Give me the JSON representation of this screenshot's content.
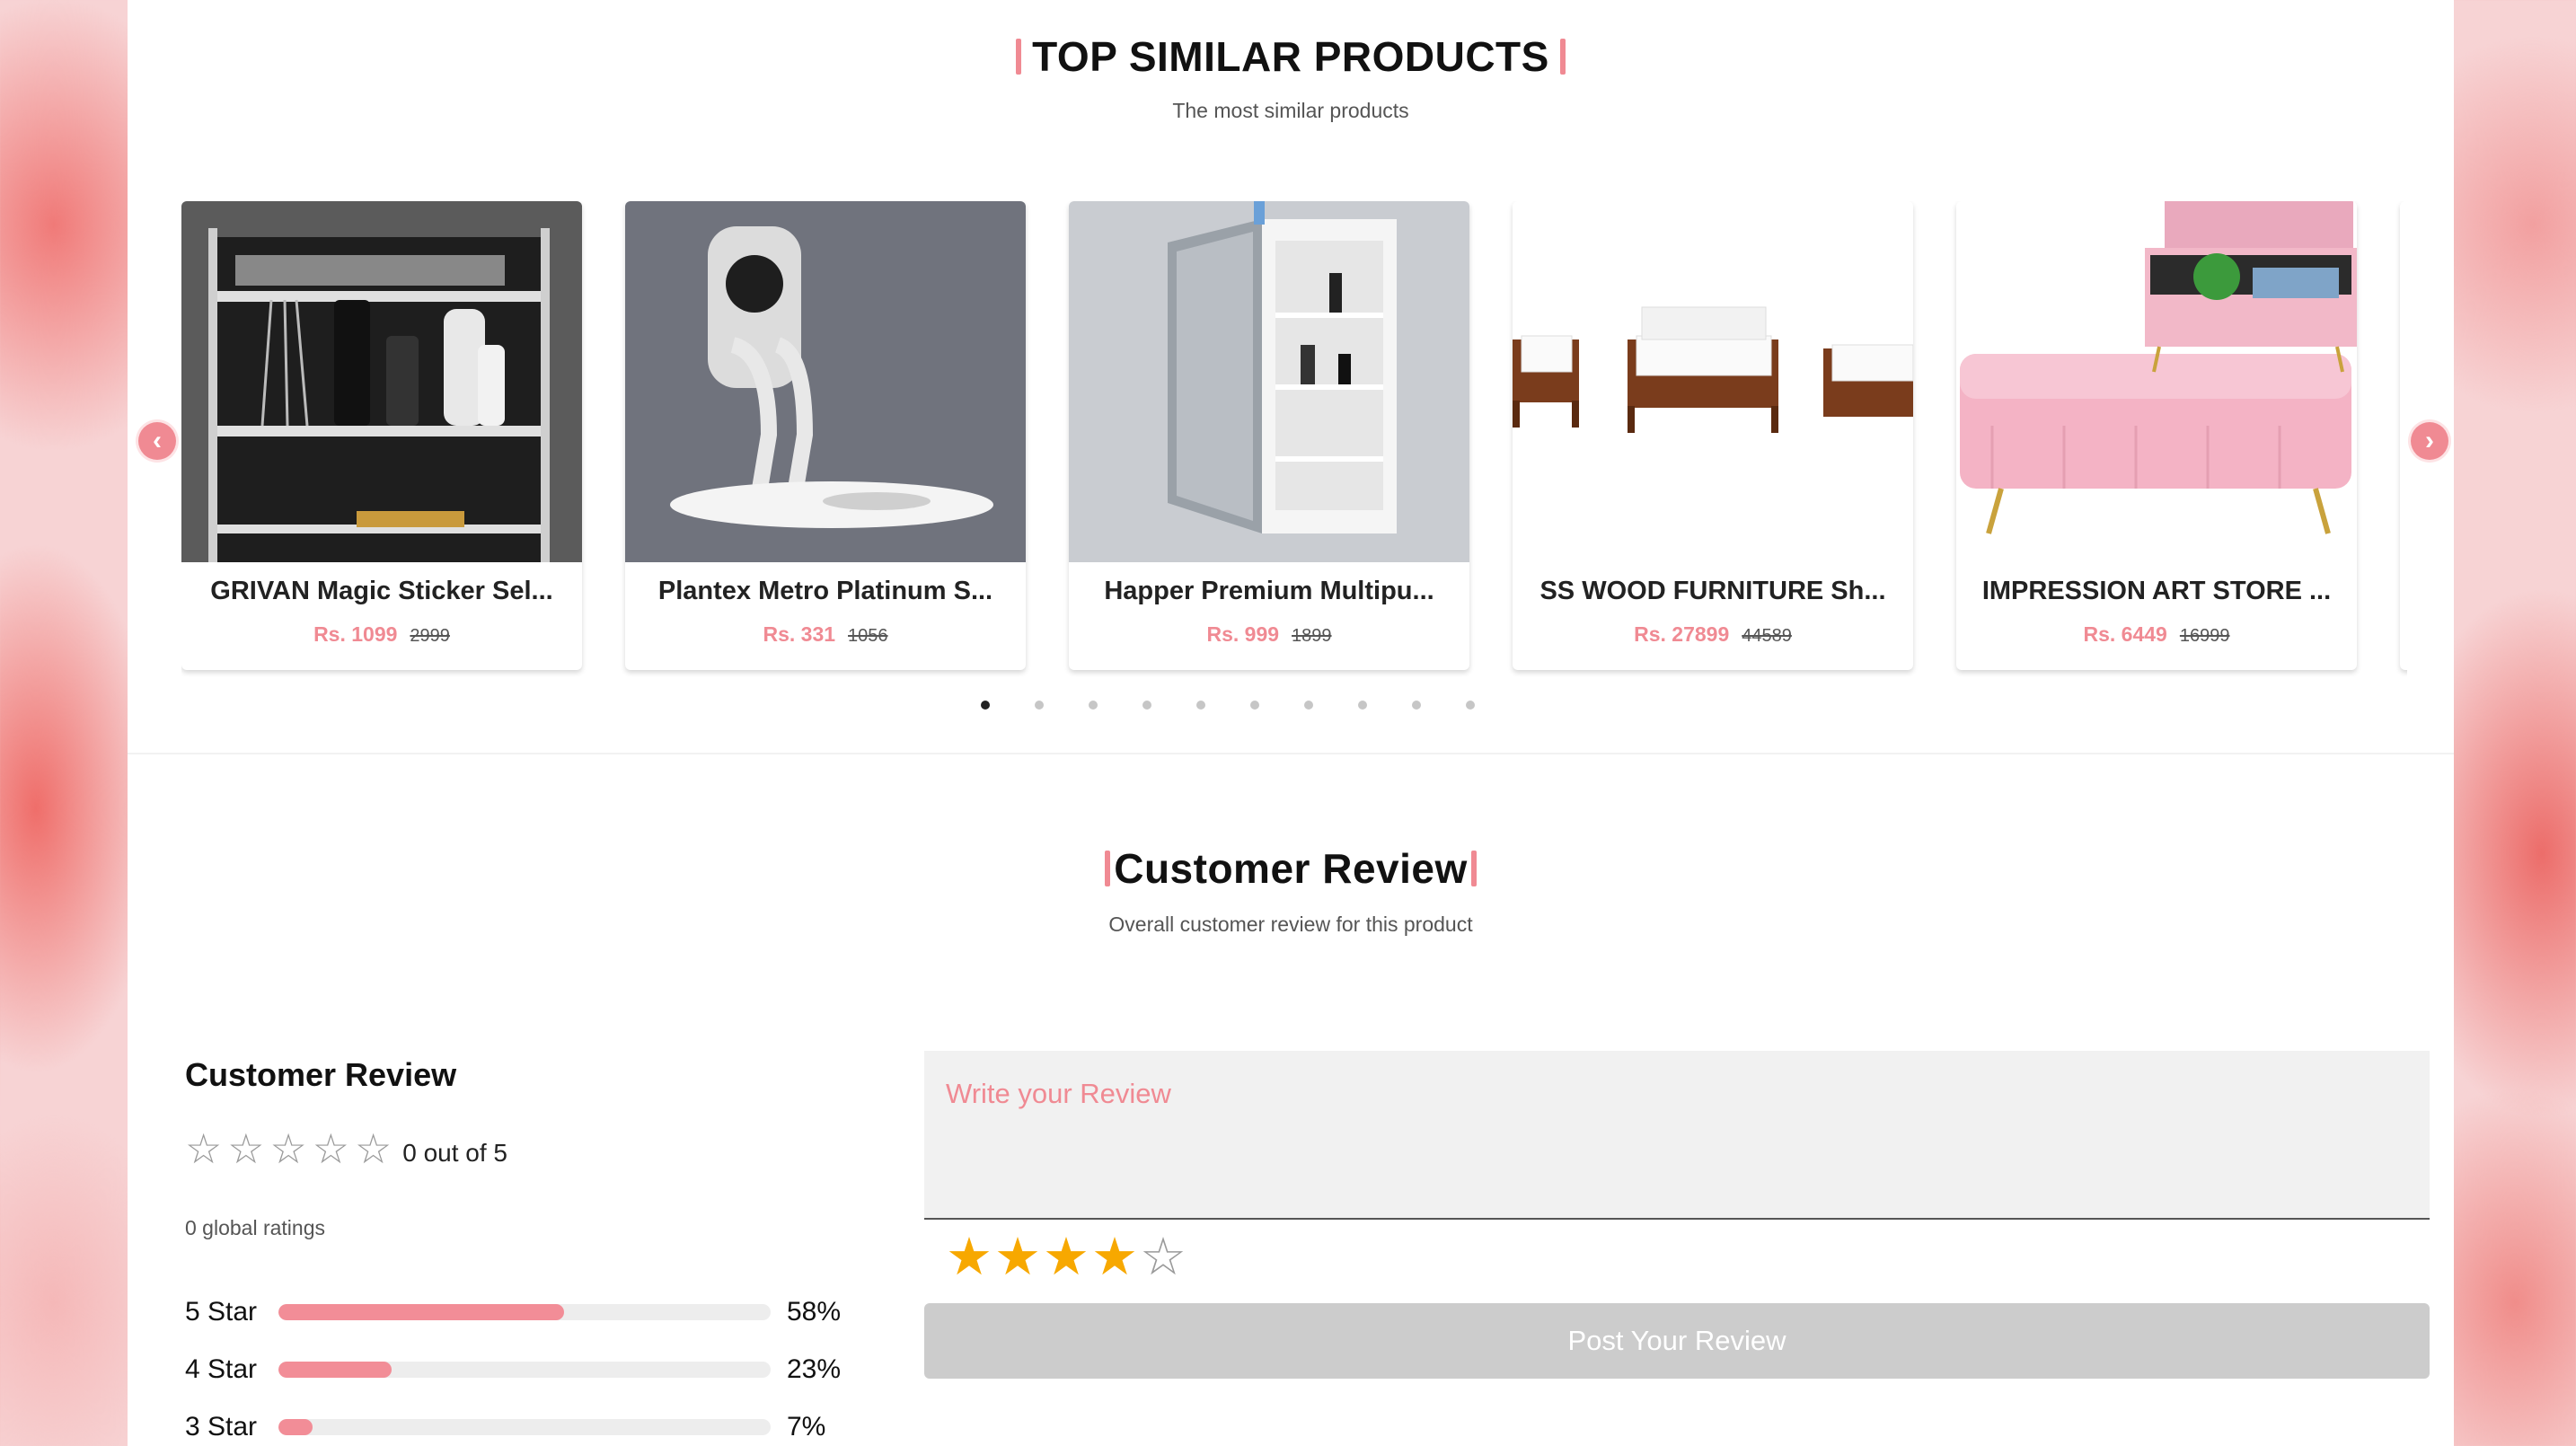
{
  "similar": {
    "title": "TOP SIMILAR PRODUCTS",
    "subtitle": "The most similar products",
    "products": [
      {
        "name": "GRIVAN Magic Sticker Sel...",
        "price": "Rs. 1099",
        "old_price": "2999"
      },
      {
        "name": "Plantex Metro Platinum S...",
        "price": "Rs. 331",
        "old_price": "1056"
      },
      {
        "name": "Happer Premium Multipu...",
        "price": "Rs. 999",
        "old_price": "1899"
      },
      {
        "name": "SS WOOD FURNITURE Sh...",
        "price": "Rs. 27899",
        "old_price": "44589"
      },
      {
        "name": "IMPRESSION ART STORE ...",
        "price": "Rs. 6449",
        "old_price": "16999"
      }
    ],
    "prev_icon": "chevron-left-icon",
    "next_icon": "chevron-right-icon",
    "prev_glyph": "‹",
    "next_glyph": "›",
    "dot_count": 10,
    "active_dot": 1,
    "accent_color": "#f08a93"
  },
  "review": {
    "title": "Customer Review",
    "subtitle": "Overall customer review for this product",
    "summary_title": "Customer Review",
    "rating_text": "0 out of 5",
    "rating_value": 0,
    "global_ratings": "0 global ratings",
    "distribution": [
      {
        "label": "5 Star",
        "percent": 58,
        "percent_text": "58%"
      },
      {
        "label": "4 Star",
        "percent": 23,
        "percent_text": "23%"
      },
      {
        "label": "3 Star",
        "percent": 7,
        "percent_text": "7%"
      }
    ],
    "input_placeholder": "Write your Review",
    "selected_stars": 4,
    "max_stars": 5,
    "post_button": "Post Your Review",
    "star_color": "#f7a800"
  }
}
